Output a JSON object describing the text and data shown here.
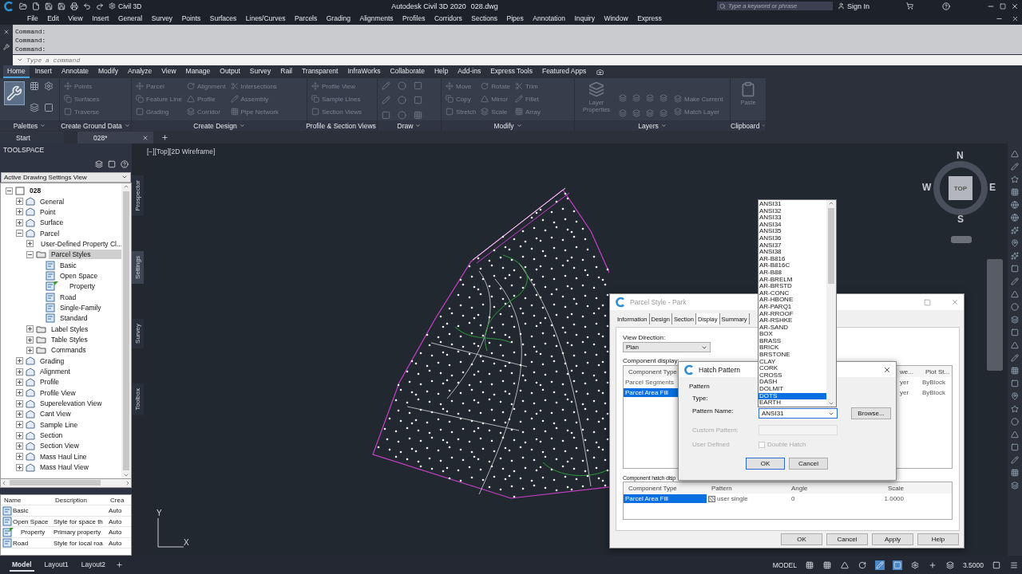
{
  "title_bar": {
    "workspace": "Civil 3D",
    "title": "Autodesk Civil 3D 2020",
    "file": "028.dwg",
    "search": {
      "placeholder": "Type a keyword or phrase"
    },
    "sign_in": "Sign In"
  },
  "menu_bar": [
    "File",
    "Edit",
    "View",
    "Insert",
    "General",
    "Survey",
    "Points",
    "Surfaces",
    "Lines/Curves",
    "Parcels",
    "Grading",
    "Alignments",
    "Profiles",
    "Corridors",
    "Sections",
    "Pipes",
    "Annotation",
    "Inquiry",
    "Window",
    "Express"
  ],
  "command_line": {
    "history": [
      "Command:",
      "Command:",
      "Command:"
    ],
    "input": {
      "placeholder": "Type a command"
    }
  },
  "ribbon": {
    "tabs": [
      {
        "label": "Home",
        "selected": true
      },
      {
        "label": "Insert",
        "selected": false
      },
      {
        "label": "Annotate",
        "selected": false
      },
      {
        "label": "Modify",
        "selected": false
      },
      {
        "label": "Analyze",
        "selected": false
      },
      {
        "label": "View",
        "selected": false
      },
      {
        "label": "Manage",
        "selected": false
      },
      {
        "label": "Output",
        "selected": false
      },
      {
        "label": "Survey",
        "selected": false
      },
      {
        "label": "Rail",
        "selected": false
      },
      {
        "label": "Transparent",
        "selected": false
      },
      {
        "label": "InfraWorks",
        "selected": false
      },
      {
        "label": "Collaborate",
        "selected": false
      },
      {
        "label": "Help",
        "selected": false
      },
      {
        "label": "Add-ins",
        "selected": false
      },
      {
        "label": "Express Tools",
        "selected": false
      },
      {
        "label": "Featured Apps",
        "selected": false
      }
    ],
    "panels": [
      {
        "title": "Palettes",
        "kind": "palettes"
      },
      {
        "title": "Create Ground Data",
        "kind": "tools",
        "columns": [
          [
            "Points",
            "Surfaces",
            "Traverse"
          ]
        ]
      },
      {
        "title": "Create Design",
        "kind": "tools",
        "columns": [
          [
            "Parcel",
            "Feature Line",
            "Grading"
          ],
          [
            "Alignment",
            "Profile",
            "Corridor"
          ],
          [
            "Intersections",
            "Assembly",
            "Pipe Network"
          ]
        ]
      },
      {
        "title": "Profile & Section Views",
        "kind": "tools",
        "columns": [
          [
            "Profile View",
            "Sample Lines",
            "Section Views"
          ]
        ]
      },
      {
        "title": "Draw",
        "kind": "icons"
      },
      {
        "title": "Modify",
        "kind": "tools",
        "columns": [
          [
            "Move",
            "Copy",
            "Stretch"
          ],
          [
            "Rotate",
            "Mirror",
            "Scale"
          ],
          [
            "Trim",
            "Fillet",
            "Array"
          ]
        ]
      },
      {
        "title": "Layers",
        "kind": "layers",
        "big_tool": "Layer Properties",
        "columns": [
          [
            "Make Current",
            "Match Layer"
          ]
        ]
      },
      {
        "title": "Clipboard",
        "kind": "clipboard",
        "big_tool": "Paste"
      }
    ]
  },
  "document_tabs": [
    {
      "label": "Start",
      "selected": false
    },
    {
      "label": "028*",
      "selected": true
    }
  ],
  "toolspace": {
    "title": "TOOLSPACE",
    "view": "Active Drawing Settings View",
    "tree": [
      {
        "label": "028",
        "kind": "drawing",
        "expanded": true,
        "selected": false,
        "children": [
          {
            "label": "General",
            "kind": "category",
            "expanded": false,
            "selected": false
          },
          {
            "label": "Point",
            "kind": "category",
            "expanded": false,
            "selected": false
          },
          {
            "label": "Surface",
            "kind": "category",
            "expanded": false,
            "selected": false
          },
          {
            "label": "Parcel",
            "kind": "category",
            "expanded": true,
            "selected": false,
            "children": [
              {
                "label": "User-Defined Property Cl...",
                "kind": "folder",
                "expanded": false,
                "selected": false
              },
              {
                "label": "Parcel Styles",
                "kind": "folder",
                "expanded": true,
                "selected": true,
                "children": [
                  {
                    "label": "Basic",
                    "kind": "style",
                    "in_use": false,
                    "selected": false
                  },
                  {
                    "label": "Open Space",
                    "kind": "style",
                    "in_use": false,
                    "selected": false
                  },
                  {
                    "label": "Property",
                    "kind": "style",
                    "in_use": true,
                    "selected": false
                  },
                  {
                    "label": "Road",
                    "kind": "style",
                    "in_use": false,
                    "selected": false
                  },
                  {
                    "label": "Single-Family",
                    "kind": "style",
                    "in_use": false,
                    "selected": false
                  },
                  {
                    "label": "Standard",
                    "kind": "style",
                    "in_use": false,
                    "selected": false
                  }
                ]
              },
              {
                "label": "Label Styles",
                "kind": "folder",
                "expanded": false,
                "selected": false
              },
              {
                "label": "Table Styles",
                "kind": "folder",
                "expanded": false,
                "selected": false
              },
              {
                "label": "Commands",
                "kind": "folder",
                "expanded": false,
                "selected": false
              }
            ]
          },
          {
            "label": "Grading",
            "kind": "category",
            "expanded": false,
            "selected": false
          },
          {
            "label": "Alignment",
            "kind": "category",
            "expanded": false,
            "selected": false
          },
          {
            "label": "Profile",
            "kind": "category",
            "expanded": false,
            "selected": false
          },
          {
            "label": "Profile View",
            "kind": "category",
            "expanded": false,
            "selected": false
          },
          {
            "label": "Superelevation View",
            "kind": "category",
            "expanded": false,
            "selected": false
          },
          {
            "label": "Cant View",
            "kind": "category",
            "expanded": false,
            "selected": false
          },
          {
            "label": "Sample Line",
            "kind": "category",
            "expanded": false,
            "selected": false
          },
          {
            "label": "Section",
            "kind": "category",
            "expanded": false,
            "selected": false
          },
          {
            "label": "Section View",
            "kind": "category",
            "expanded": false,
            "selected": false
          },
          {
            "label": "Mass Haul Line",
            "kind": "category",
            "expanded": false,
            "selected": false
          },
          {
            "label": "Mass Haul View",
            "kind": "category",
            "expanded": false,
            "selected": false
          }
        ]
      }
    ],
    "side_tabs": [
      {
        "label": "Prospector",
        "selected": false
      },
      {
        "label": "Settings",
        "selected": true
      },
      {
        "label": "Survey",
        "selected": false
      },
      {
        "label": "Toolbox",
        "selected": false
      }
    ],
    "list": {
      "columns": [
        "Name",
        "Description",
        "Crea"
      ],
      "rows": [
        {
          "name": "Basic",
          "created": "Auto",
          "in_use": false
        },
        {
          "name": "Open Space",
          "description": "Style for space th",
          "created": "Auto",
          "in_use": false
        },
        {
          "name": "Property",
          "description": "Primary property",
          "created": "Auto",
          "in_use": true
        },
        {
          "name": "Road",
          "description": "Style for local roa",
          "created": "Auto",
          "in_use": false
        }
      ]
    }
  },
  "viewport": {
    "label": "[−][Top][2D Wireframe]",
    "view_cube": {
      "face": "TOP",
      "north": "N",
      "south": "S",
      "east": "E",
      "west": "W"
    },
    "ucs": {
      "y": "Y",
      "x": "X"
    }
  },
  "parcel_style_dialog": {
    "title": "Parcel Style - Park",
    "tabs": [
      {
        "label": "Information",
        "selected": false
      },
      {
        "label": "Design",
        "selected": false
      },
      {
        "label": "Section",
        "selected": false
      },
      {
        "label": "Display",
        "selected": true
      },
      {
        "label": "Summary",
        "selected": false
      }
    ],
    "view_direction": {
      "label": "View Direction:",
      "value": "Plan"
    },
    "component_display": {
      "label": "Component display:",
      "columns": [
        "Component Type",
        "we...",
        "Plot St..."
      ],
      "rows": [
        {
          "cells": [
            "Parcel Segments",
            "yer",
            "ByBlock"
          ],
          "selected": false
        },
        {
          "cells": [
            "Parcel Area Fill",
            "yer",
            "ByBlock"
          ],
          "selected": true
        }
      ]
    },
    "hatch_display": {
      "label": "Component hatch disp",
      "columns": [
        "Component Type",
        "Pattern",
        "Angle",
        "Scale"
      ],
      "rows": [
        {
          "cells": [
            "Parcel Area Fill",
            "user single",
            "0",
            "1.0000"
          ],
          "selected": true
        }
      ]
    },
    "buttons": [
      "OK",
      "Cancel",
      "Apply",
      "Help"
    ]
  },
  "hatch_dialog": {
    "title": "Hatch Pattern",
    "group": "Pattern",
    "type_label": "Type:",
    "pattern_name": {
      "label": "Pattern Name:",
      "value": "ANSI31"
    },
    "browse": "Browse...",
    "custom_pattern": {
      "label": "Custom Pattern:",
      "disabled": true
    },
    "user_defined": {
      "label": "User Defined",
      "disabled": true
    },
    "double_hatch": {
      "label": "Double Hatch",
      "checked": false,
      "disabled": true
    },
    "buttons": [
      "OK",
      "Cancel"
    ],
    "pattern_list": [
      {
        "label": "ANSI31",
        "selected": false
      },
      {
        "label": "ANSI32",
        "selected": false
      },
      {
        "label": "ANSI33",
        "selected": false
      },
      {
        "label": "ANSI34",
        "selected": false
      },
      {
        "label": "ANSI35",
        "selected": false
      },
      {
        "label": "ANSI36",
        "selected": false
      },
      {
        "label": "ANSI37",
        "selected": false
      },
      {
        "label": "ANSI38",
        "selected": false
      },
      {
        "label": "AR-B816",
        "selected": false
      },
      {
        "label": "AR-B816C",
        "selected": false
      },
      {
        "label": "AR-B88",
        "selected": false
      },
      {
        "label": "AR-BRELM",
        "selected": false
      },
      {
        "label": "AR-BRSTD",
        "selected": false
      },
      {
        "label": "AR-CONC",
        "selected": false
      },
      {
        "label": "AR-HBONE",
        "selected": false
      },
      {
        "label": "AR-PARQ1",
        "selected": false
      },
      {
        "label": "AR-RROOF",
        "selected": false
      },
      {
        "label": "AR-RSHKE",
        "selected": false
      },
      {
        "label": "AR-SAND",
        "selected": false
      },
      {
        "label": "BOX",
        "selected": false
      },
      {
        "label": "BRASS",
        "selected": false
      },
      {
        "label": "BRICK",
        "selected": false
      },
      {
        "label": "BRSTONE",
        "selected": false
      },
      {
        "label": "CLAY",
        "selected": false
      },
      {
        "label": "CORK",
        "selected": false
      },
      {
        "label": "CROSS",
        "selected": false
      },
      {
        "label": "DASH",
        "selected": false
      },
      {
        "label": "DOLMIT",
        "selected": false
      },
      {
        "label": "DOTS",
        "selected": true
      },
      {
        "label": "EARTH",
        "selected": false
      }
    ]
  },
  "status_bar": {
    "layout_tabs": [
      {
        "label": "Model",
        "selected": true
      },
      {
        "label": "Layout1",
        "selected": false
      },
      {
        "label": "Layout2",
        "selected": false
      }
    ],
    "mode": "MODEL",
    "scale": "3.5000"
  }
}
